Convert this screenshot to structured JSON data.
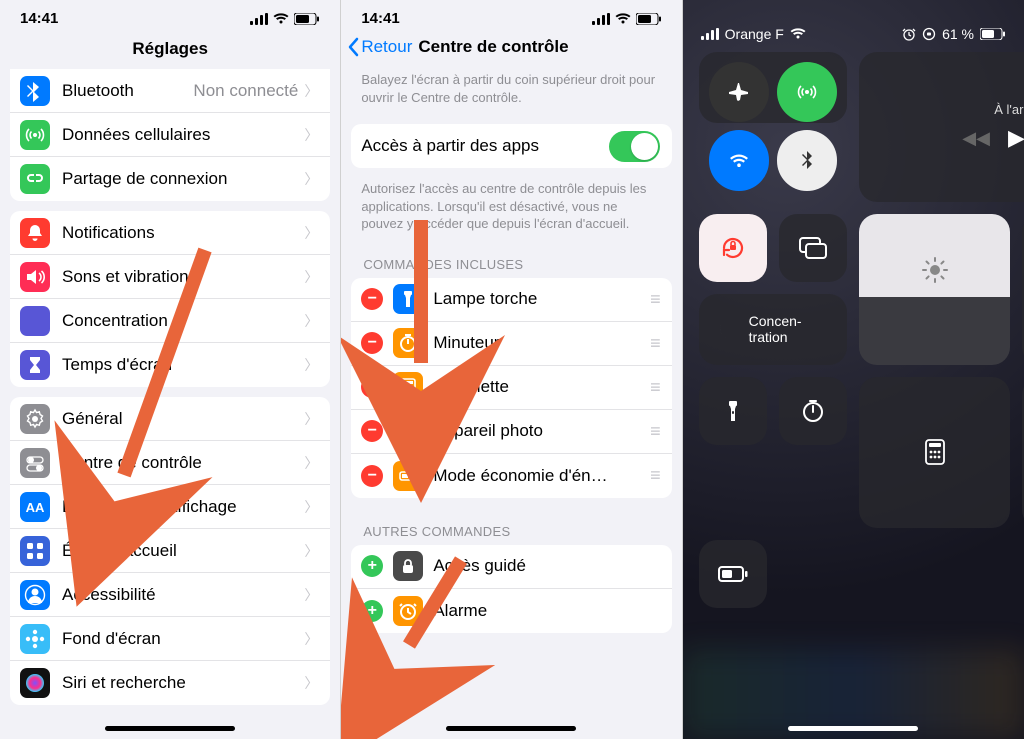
{
  "phone1": {
    "time": "14:41",
    "title": "Réglages",
    "items_a": [
      {
        "label": "Bluetooth",
        "aux": "Non connecté",
        "color": "#007aff",
        "glyph": "bt"
      },
      {
        "label": "Données cellulaires",
        "color": "#34c759",
        "glyph": "antenna"
      },
      {
        "label": "Partage de connexion",
        "color": "#34c759",
        "glyph": "link"
      }
    ],
    "items_b": [
      {
        "label": "Notifications",
        "color": "#ff3b30",
        "glyph": "bell"
      },
      {
        "label": "Sons et vibrations",
        "color": "#ff2d55",
        "glyph": "speaker"
      },
      {
        "label": "Concentration",
        "color": "#5856d6",
        "glyph": "moon"
      },
      {
        "label": "Temps d'écran",
        "color": "#5856d6",
        "glyph": "hourglass"
      }
    ],
    "items_c": [
      {
        "label": "Général",
        "color": "#8e8e93",
        "glyph": "gear"
      },
      {
        "label": "Centre de contrôle",
        "color": "#8e8e93",
        "glyph": "switches"
      },
      {
        "label": "Luminosité et affichage",
        "color": "#007aff",
        "glyph": "aa"
      },
      {
        "label": "Écran d'accueil",
        "color": "#3763d9",
        "glyph": "grid"
      },
      {
        "label": "Accessibilité",
        "color": "#007aff",
        "glyph": "person"
      },
      {
        "label": "Fond d'écran",
        "color": "#38bdf8",
        "glyph": "flower"
      },
      {
        "label": "Siri et recherche",
        "color": "#111",
        "glyph": "siri"
      }
    ]
  },
  "phone2": {
    "time": "14:41",
    "back": "Retour",
    "title": "Centre de contrôle",
    "desc_top": "Balayez l'écran à partir du coin supérieur droit pour ouvrir le Centre de contrôle.",
    "access_label": "Accès à partir des apps",
    "desc_access": "Autorisez l'accès au centre de contrôle depuis les applications. Lorsqu'il est désactivé, vous ne pouvez y accéder que depuis l'écran d'accueil.",
    "header_included": "Commandes incluses",
    "header_more": "Autres commandes",
    "included": [
      {
        "label": "Lampe torche",
        "color": "#007aff",
        "glyph": "torch"
      },
      {
        "label": "Minuteur",
        "color": "#ff9500",
        "glyph": "timer"
      },
      {
        "label": "Calculette",
        "color": "#ff9500",
        "glyph": "calc"
      },
      {
        "label": "Appareil photo",
        "color": "#8e8e93",
        "glyph": "camera"
      },
      {
        "label": "Mode économie d'én…",
        "color": "#ff9500",
        "glyph": "battery"
      }
    ],
    "more": [
      {
        "label": "Accès guidé",
        "color": "#4a4a4a",
        "glyph": "lock"
      },
      {
        "label": "Alarme",
        "color": "#ff9500",
        "glyph": "alarm"
      }
    ]
  },
  "phone3": {
    "carrier": "Orange F",
    "battery_pct": "61 %",
    "media_label": "À l'arrêt",
    "concentration": "Concen-\ntration"
  }
}
